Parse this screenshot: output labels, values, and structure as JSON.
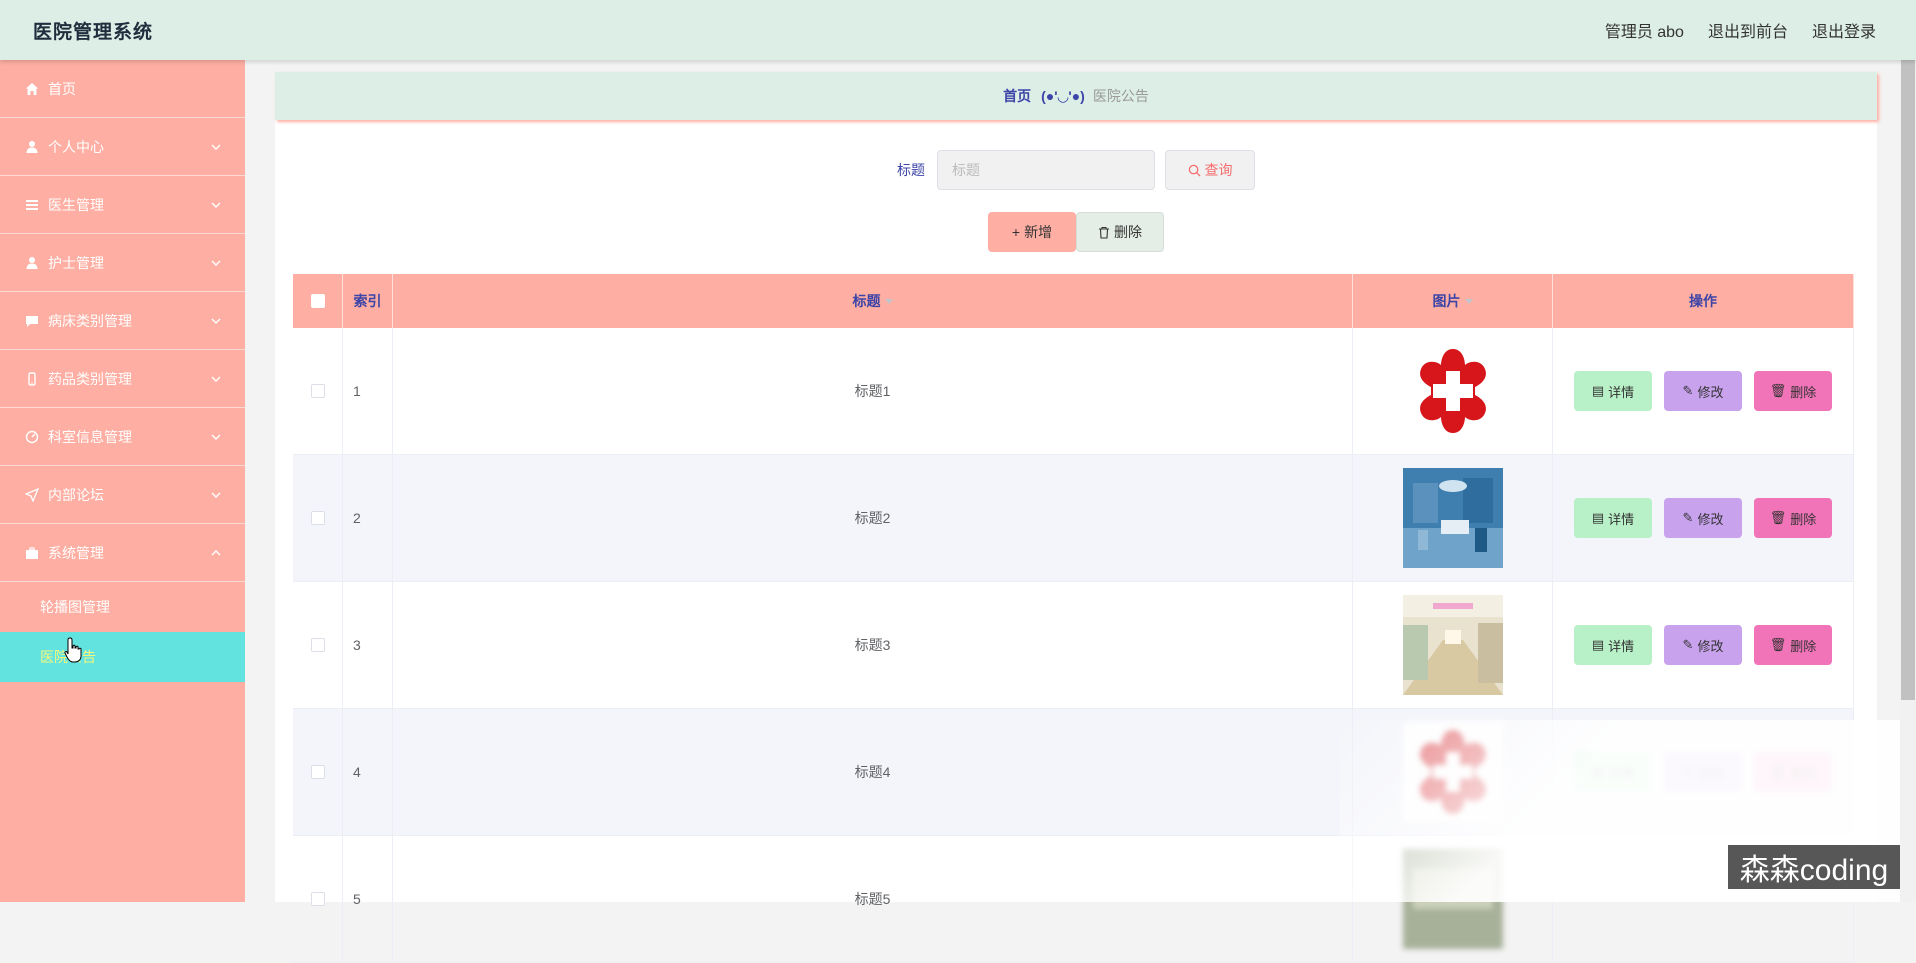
{
  "header": {
    "title": "医院管理系统",
    "user": "管理员 abo",
    "to_front": "退出到前台",
    "logout": "退出登录"
  },
  "sidebar": {
    "items": [
      {
        "label": "首页",
        "icon": "home-icon"
      },
      {
        "label": "个人中心",
        "icon": "user-icon"
      },
      {
        "label": "医生管理",
        "icon": "list-icon"
      },
      {
        "label": "护士管理",
        "icon": "user-icon"
      },
      {
        "label": "病床类别管理",
        "icon": "chat-icon"
      },
      {
        "label": "药品类别管理",
        "icon": "phone-icon"
      },
      {
        "label": "科室信息管理",
        "icon": "gauge-icon"
      },
      {
        "label": "内部论坛",
        "icon": "send-icon"
      },
      {
        "label": "系统管理",
        "icon": "briefcase-icon"
      }
    ],
    "submenu": [
      {
        "label": "轮播图管理"
      },
      {
        "label": "医院公告"
      }
    ]
  },
  "breadcrumb": {
    "home": "首页",
    "face": "(●'◡'●)",
    "current": "医院公告"
  },
  "search": {
    "label": "标题",
    "placeholder": "标题",
    "button": "查询"
  },
  "actions": {
    "add": "新增",
    "delete": "删除"
  },
  "table": {
    "headers": {
      "index": "索引",
      "title": "标题",
      "image": "图片",
      "ops": "操作"
    },
    "rows": [
      {
        "index": "1",
        "title": "标题1"
      },
      {
        "index": "2",
        "title": "标题2"
      },
      {
        "index": "3",
        "title": "标题3"
      },
      {
        "index": "4",
        "title": "标题4"
      },
      {
        "index": "5",
        "title": "标题5"
      }
    ],
    "op_labels": {
      "detail": "详情",
      "edit": "修改",
      "delete": "删除"
    }
  },
  "watermark": "森森coding",
  "colors": {
    "topbar": "#ddeee6",
    "sidebar": "#feaea2",
    "active_menu": "#63e3df",
    "accent_text": "#3d45a8",
    "detail_btn": "#b8f0c7",
    "edit_btn": "#c9a2ee",
    "delete_btn": "#f173b8"
  }
}
